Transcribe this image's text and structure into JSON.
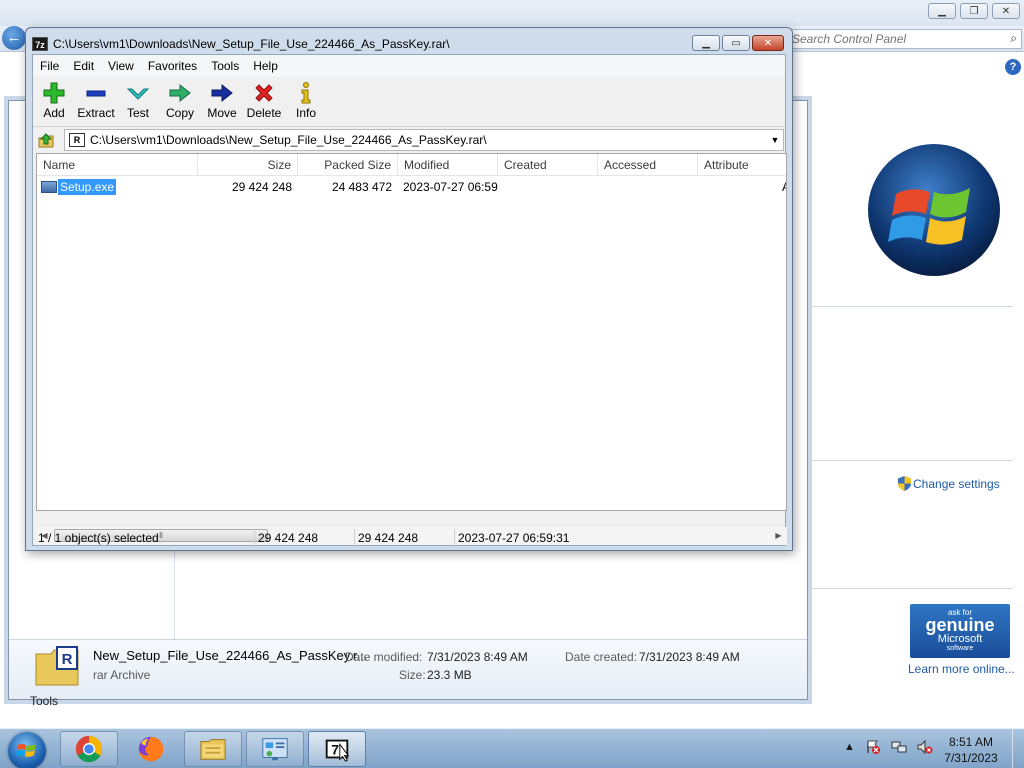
{
  "control_panel": {
    "search_placeholder": "Search Control Panel",
    "change_settings": "Change settings",
    "genuine_line1": "ask for",
    "genuine_line2": "genuine",
    "genuine_line3": "Microsoft",
    "genuine_line4": "software",
    "learn_more": "Learn more online..."
  },
  "explorer": {
    "file_name": "New_Setup_File_Use_224466_As_PassKey.r...",
    "file_type": "rar Archive",
    "date_modified_label": "Date modified:",
    "date_modified_value": "7/31/2023 8:49 AM",
    "date_created_label": "Date created:",
    "date_created_value": "7/31/2023 8:49 AM",
    "size_label": "Size:",
    "size_value": "23.3 MB",
    "tools_label": "Tools"
  },
  "zip": {
    "app_icon_text": "7z",
    "title": "C:\\Users\\vm1\\Downloads\\New_Setup_File_Use_224466_As_PassKey.rar\\",
    "menu": [
      "File",
      "Edit",
      "View",
      "Favorites",
      "Tools",
      "Help"
    ],
    "toolbar": [
      "Add",
      "Extract",
      "Test",
      "Copy",
      "Move",
      "Delete",
      "Info"
    ],
    "path": "C:\\Users\\vm1\\Downloads\\New_Setup_File_Use_224466_As_PassKey.rar\\",
    "columns": [
      "Name",
      "Size",
      "Packed Size",
      "Modified",
      "Created",
      "Accessed",
      "Attribute"
    ],
    "rows": [
      {
        "name": "Setup.exe",
        "size": "29 424 248",
        "packed": "24 483 472",
        "modified": "2023-07-27 06:59",
        "created": "",
        "accessed": "",
        "attr": "A"
      }
    ],
    "status": {
      "selected": "1 / 1 object(s) selected",
      "size": "29 424 248",
      "packed": "29 424 248",
      "modified": "2023-07-27 06:59:31"
    }
  },
  "taskbar": {
    "time": "8:51 AM",
    "date": "7/31/2023",
    "items": [
      "start-button",
      "chrome-icon",
      "firefox-icon",
      "file-explorer-icon",
      "control-panel-icon",
      "7zip-icon"
    ]
  }
}
